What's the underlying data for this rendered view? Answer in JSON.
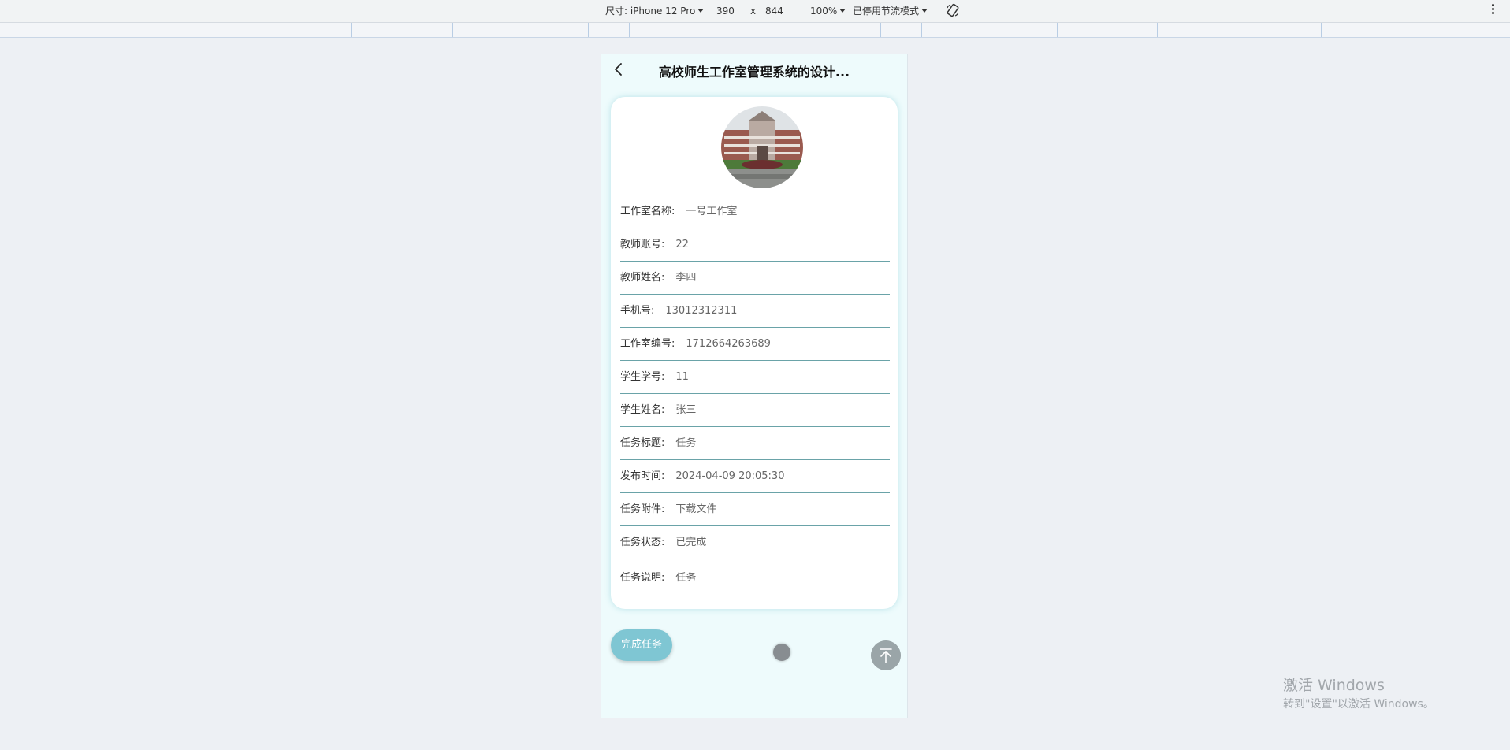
{
  "devtools": {
    "dimensions_label": "尺寸: iPhone 12 Pro",
    "width": "390",
    "times": "x",
    "height": "844",
    "zoom": "100%",
    "throttle": "已停用节流模式"
  },
  "nav": {
    "title": "高校师生工作室管理系统的设计..."
  },
  "colors": {
    "accent": "#7fc6d3",
    "phone_bg": "#eefbfc",
    "divider": "#6aa3a8"
  },
  "detail_rows": [
    {
      "label": "工作室名称:",
      "value": "一号工作室"
    },
    {
      "label": "教师账号:",
      "value": "22"
    },
    {
      "label": "教师姓名:",
      "value": "李四"
    },
    {
      "label": "手机号:",
      "value": "13012312311"
    },
    {
      "label": "工作室编号:",
      "value": "1712664263689"
    },
    {
      "label": "学生学号:",
      "value": "11"
    },
    {
      "label": "学生姓名:",
      "value": "张三"
    },
    {
      "label": "任务标题:",
      "value": "任务"
    },
    {
      "label": "发布时间:",
      "value": "2024-04-09 20:05:30"
    },
    {
      "label": "任务附件:",
      "value": "下载文件"
    },
    {
      "label": "任务状态:",
      "value": "已完成"
    },
    {
      "label": "任务说明:",
      "value": "任务"
    }
  ],
  "actions": {
    "complete_label": "完成任务"
  },
  "icons": {
    "back": "chevron-left-icon",
    "top": "arrow-up-to-top-icon",
    "rotate": "rotate-icon"
  },
  "watermark": {
    "line1": "激活 Windows",
    "line2": "转到\"设置\"以激活 Windows。"
  }
}
